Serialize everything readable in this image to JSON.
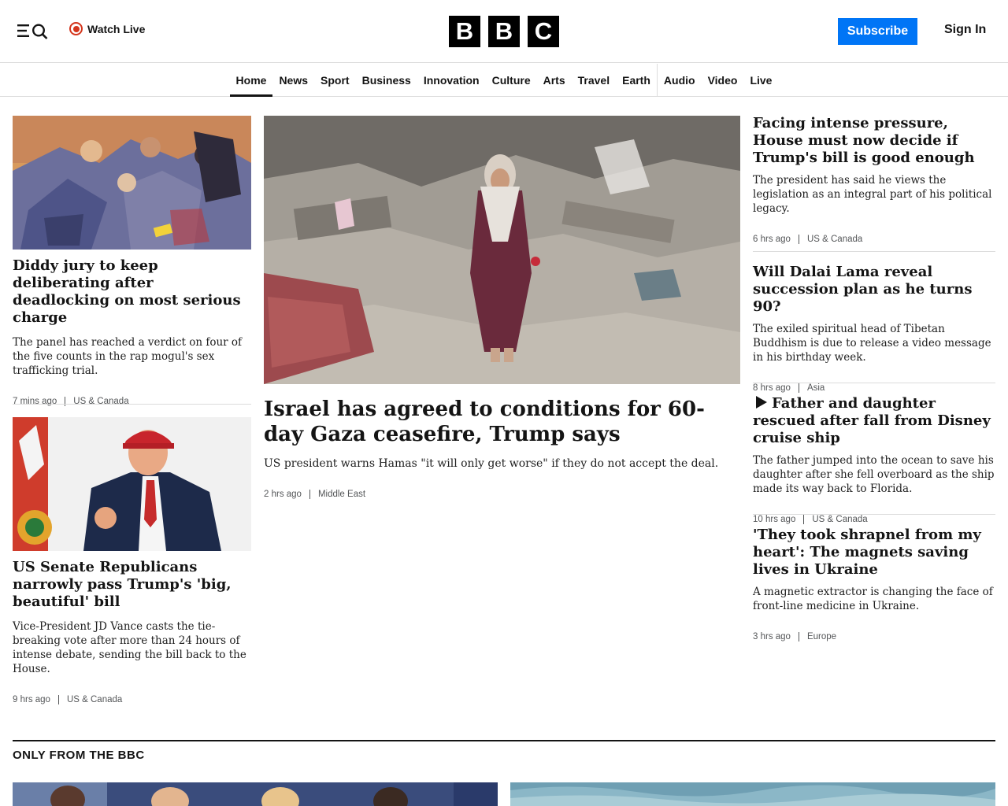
{
  "header": {
    "watch_live": "Watch Live",
    "logo_letters": [
      "B",
      "B",
      "C"
    ],
    "subscribe": "Subscribe",
    "sign_in": "Sign In",
    "accent_color": "#0075f6",
    "live_color": "#d4351c"
  },
  "nav": {
    "items": [
      "Home",
      "News",
      "Sport",
      "Business",
      "Innovation",
      "Culture",
      "Arts",
      "Travel",
      "Earth",
      "Audio",
      "Video",
      "Live"
    ],
    "active": "Home"
  },
  "left": [
    {
      "image": "courtroom-sketch",
      "headline": "Diddy jury to keep deliberating after deadlocking on most serious charge",
      "summary": "The panel has reached a verdict on four of the five counts in the rap mogul's sex trafficking trial.",
      "time": "7 mins ago",
      "category": "US & Canada"
    },
    {
      "image": "trump-photo",
      "headline": "US Senate Republicans narrowly pass Trump's 'big, beautiful' bill",
      "summary": "Vice-President JD Vance casts the tie-breaking vote after more than 24 hours of intense debate, sending the bill back to the House.",
      "time": "9 hrs ago",
      "category": "US & Canada"
    }
  ],
  "main": {
    "image": "gaza-rubble-photo",
    "headline": "Israel has agreed to conditions for 60-day Gaza ceasefire, Trump says",
    "summary": "US president warns Hamas \"it will only get worse\" if they do not accept the deal.",
    "time": "2 hrs ago",
    "category": "Middle East"
  },
  "right": [
    {
      "headline": "Facing intense pressure, House must now decide if Trump's bill is good enough",
      "summary": "The president has said he views the legislation as an integral part of his political legacy.",
      "time": "6 hrs ago",
      "category": "US & Canada"
    },
    {
      "headline": "Will Dalai Lama reveal succession plan as he turns 90?",
      "summary": "The exiled spiritual head of Tibetan Buddhism is due to release a video message in his birthday week.",
      "time": "8 hrs ago",
      "category": "Asia"
    },
    {
      "headline": "Father and daughter rescued after fall from Disney cruise ship",
      "has_video": true,
      "summary": "The father jumped into the ocean to save his daughter after she fell overboard as the ship made its way back to Florida.",
      "time": "10 hrs ago",
      "category": "US & Canada"
    },
    {
      "headline": "'They took shrapnel from my heart': The magnets saving lives in Ukraine",
      "summary": "A magnetic extractor is changing the face of front-line medicine in Ukraine.",
      "time": "3 hrs ago",
      "category": "Europe"
    }
  ],
  "section": {
    "title": "ONLY FROM THE BBC"
  }
}
